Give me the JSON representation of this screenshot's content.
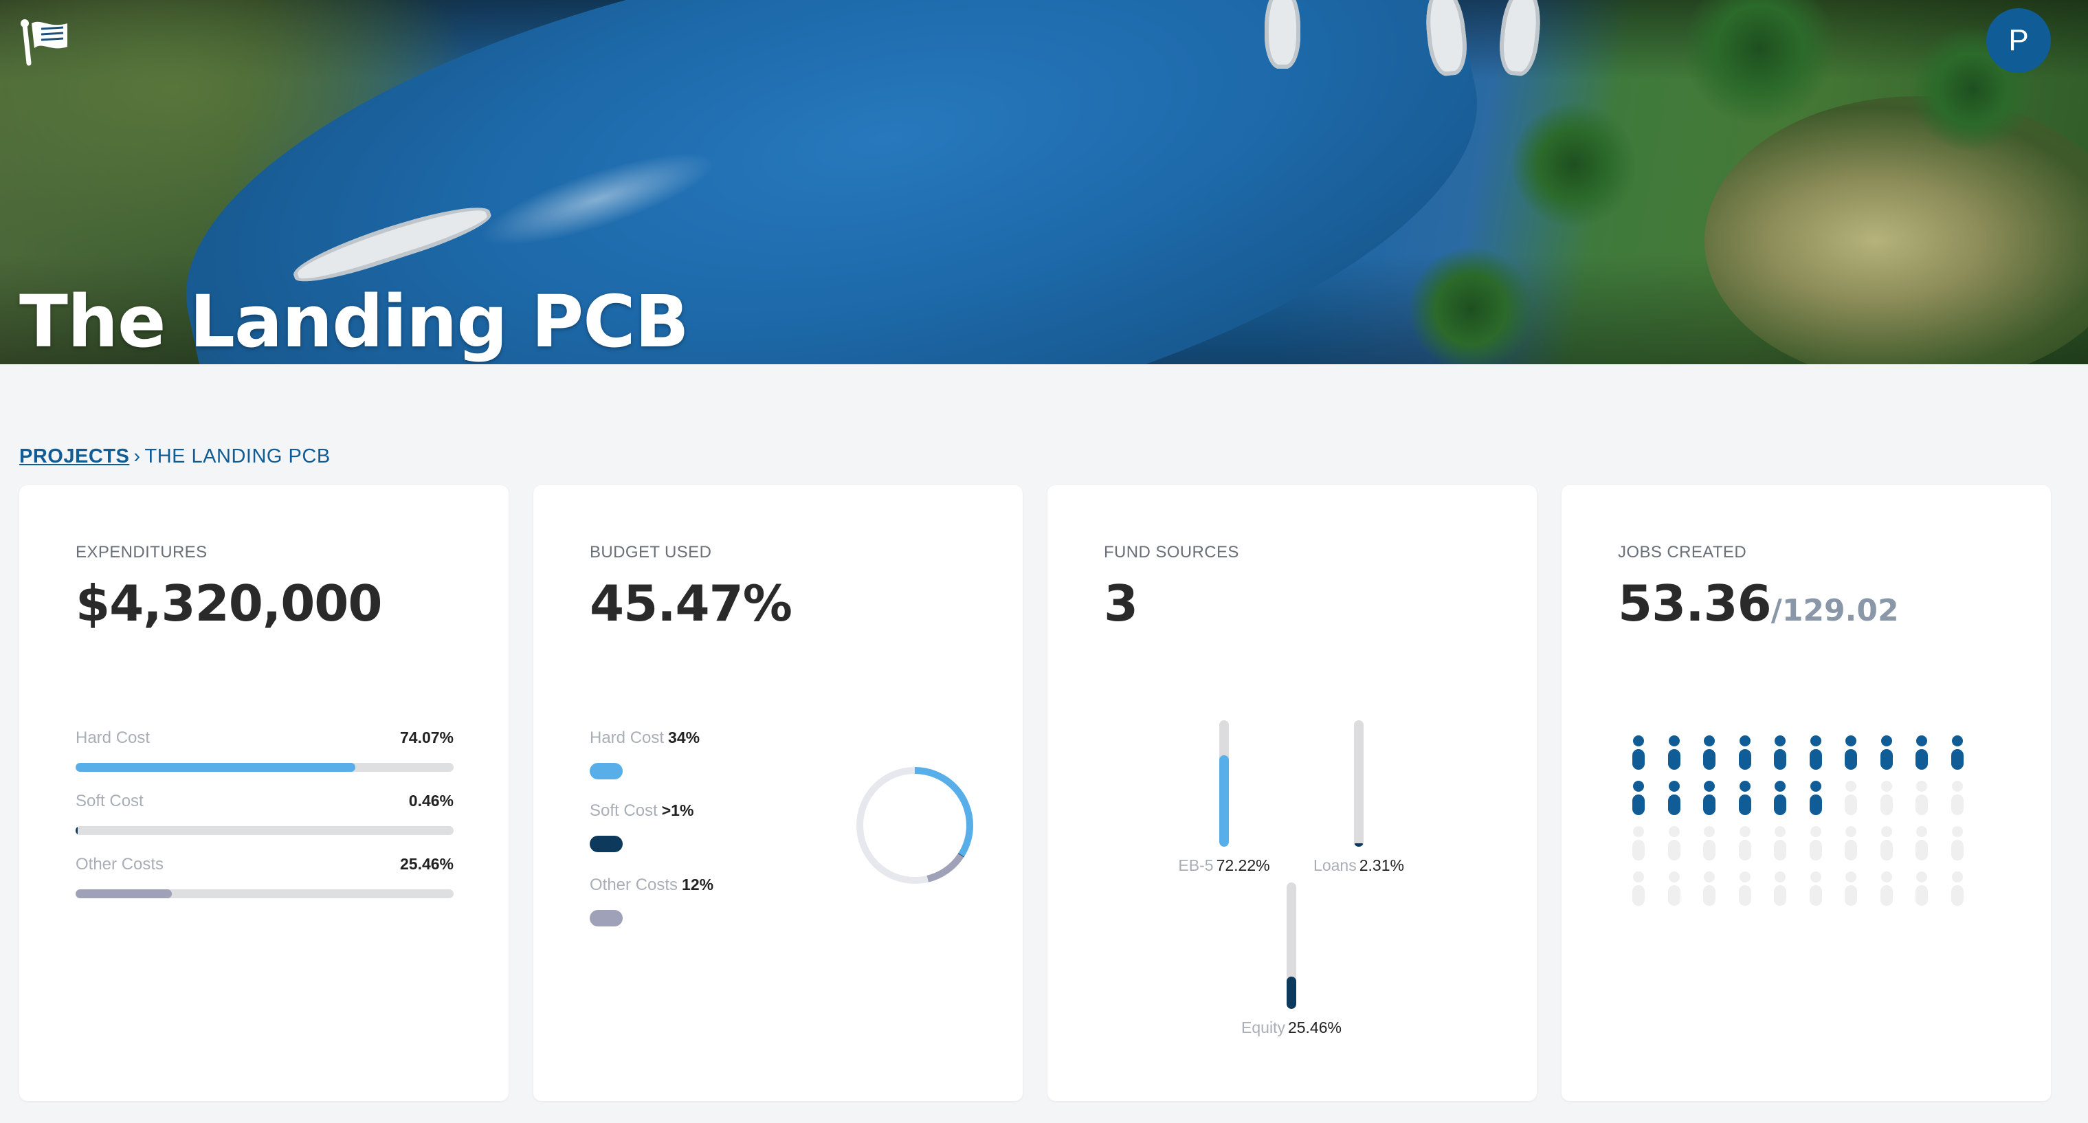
{
  "header": {
    "title": "The Landing PCB",
    "avatar_initial": "P",
    "logo_icon": "flag-logo-icon"
  },
  "breadcrumb": {
    "root": "PROJECTS",
    "separator": "›",
    "current": "THE LANDING PCB"
  },
  "expenditures": {
    "label": "EXPENDITURES",
    "value": "$4,320,000",
    "items": [
      {
        "name": "Hard Cost",
        "percent_label": "74.07%",
        "percent": 74.07,
        "color": "#57aee9"
      },
      {
        "name": "Soft Cost",
        "percent_label": "0.46%",
        "percent": 0.46,
        "color": "#0d3a5c"
      },
      {
        "name": "Other Costs",
        "percent_label": "25.46%",
        "percent": 25.46,
        "color": "#9ea1b7"
      }
    ]
  },
  "budget": {
    "label": "BUDGET USED",
    "value": "45.47%",
    "used_fraction": 0.4547,
    "items": [
      {
        "name": "Hard Cost",
        "percent_label": "34%",
        "share": 34,
        "color": "#57aee9"
      },
      {
        "name": "Soft Cost",
        "percent_label": ">1%",
        "share": 0.2,
        "color": "#0d3a5c"
      },
      {
        "name": "Other Costs",
        "percent_label": "12%",
        "share": 12,
        "color": "#9ea1b7"
      }
    ],
    "track_color": "#e6e8ee"
  },
  "funds": {
    "label": "FUND SOURCES",
    "value": "3",
    "items": [
      {
        "name": "EB-5",
        "percent_label": "72.22%",
        "percent": 72.22,
        "color": "#57aee9"
      },
      {
        "name": "Loans",
        "percent_label": "2.31%",
        "percent": 2.31,
        "color": "#0d3a5c"
      },
      {
        "name": "Equity",
        "percent_label": "25.46%",
        "percent": 25.46,
        "color": "#0d3a5c"
      }
    ]
  },
  "jobs": {
    "label": "JOBS CREATED",
    "value": "53.36",
    "total": "/129.02",
    "icons_total": 40,
    "icons_filled": 16,
    "filled_color": "#0f5c96",
    "empty_color": "#efefef",
    "icon_name": "person-icon"
  }
}
